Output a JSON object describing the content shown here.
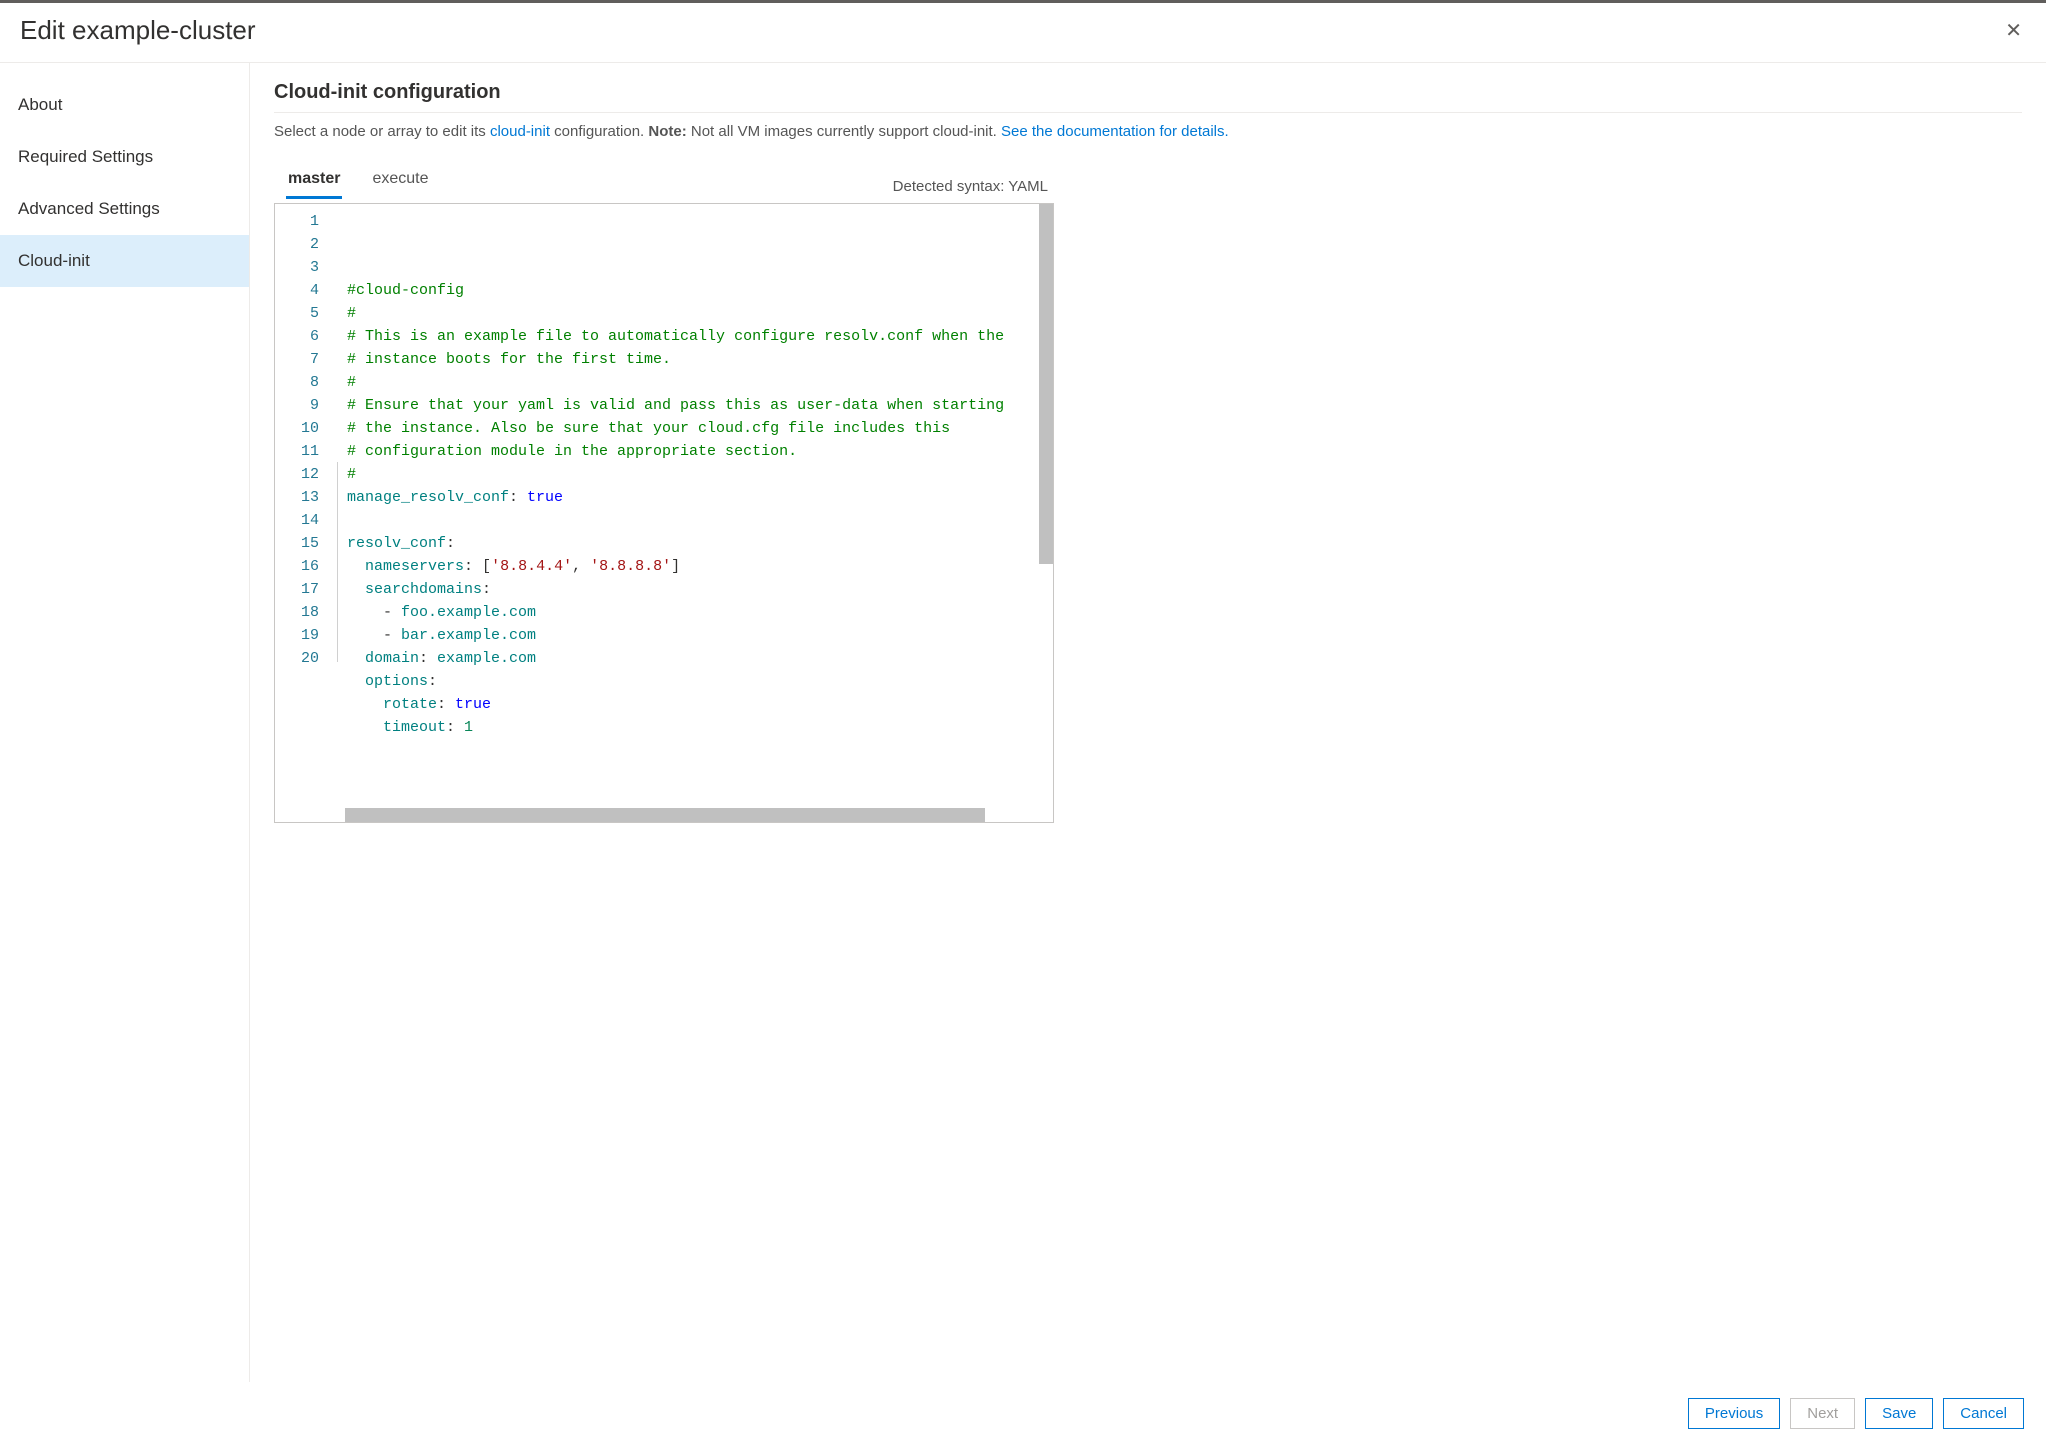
{
  "header": {
    "title": "Edit example-cluster"
  },
  "sidebar": {
    "items": [
      {
        "label": "About",
        "active": false
      },
      {
        "label": "Required Settings",
        "active": false
      },
      {
        "label": "Advanced Settings",
        "active": false
      },
      {
        "label": "Cloud-init",
        "active": true
      }
    ]
  },
  "main": {
    "section_title": "Cloud-init configuration",
    "desc_pre": "Select a node or array to edit its ",
    "desc_link1": "cloud-init",
    "desc_mid": " configuration. ",
    "desc_note_label": "Note:",
    "desc_note_text": " Not all VM images currently support cloud-init. ",
    "desc_link2": "See the documentation for details.",
    "tabs": [
      {
        "label": "master",
        "active": true
      },
      {
        "label": "execute",
        "active": false
      }
    ],
    "syntax_label": "Detected syntax: YAML"
  },
  "editor": {
    "lines": [
      [
        {
          "cls": "c-comment",
          "t": "#cloud-config"
        }
      ],
      [
        {
          "cls": "c-comment",
          "t": "#"
        }
      ],
      [
        {
          "cls": "c-comment",
          "t": "# This is an example file to automatically configure resolv.conf when the"
        }
      ],
      [
        {
          "cls": "c-comment",
          "t": "# instance boots for the first time."
        }
      ],
      [
        {
          "cls": "c-comment",
          "t": "#"
        }
      ],
      [
        {
          "cls": "c-comment",
          "t": "# Ensure that your yaml is valid and pass this as user-data when starting"
        }
      ],
      [
        {
          "cls": "c-comment",
          "t": "# the instance. Also be sure that your cloud.cfg file includes this"
        }
      ],
      [
        {
          "cls": "c-comment",
          "t": "# configuration module in the appropriate section."
        }
      ],
      [
        {
          "cls": "c-comment",
          "t": "#"
        }
      ],
      [
        {
          "cls": "c-key",
          "t": "manage_resolv_conf"
        },
        {
          "cls": "c-colon",
          "t": ": "
        },
        {
          "cls": "c-bool",
          "t": "true"
        }
      ],
      [],
      [
        {
          "cls": "c-key",
          "t": "resolv_conf"
        },
        {
          "cls": "c-colon",
          "t": ":"
        }
      ],
      [
        {
          "cls": "c-plain",
          "t": "  "
        },
        {
          "cls": "c-key",
          "t": "nameservers"
        },
        {
          "cls": "c-colon",
          "t": ": ["
        },
        {
          "cls": "c-string",
          "t": "'8.8.4.4'"
        },
        {
          "cls": "c-colon",
          "t": ", "
        },
        {
          "cls": "c-string",
          "t": "'8.8.8.8'"
        },
        {
          "cls": "c-colon",
          "t": "]"
        }
      ],
      [
        {
          "cls": "c-plain",
          "t": "  "
        },
        {
          "cls": "c-key",
          "t": "searchdomains"
        },
        {
          "cls": "c-colon",
          "t": ":"
        }
      ],
      [
        {
          "cls": "c-plain",
          "t": "    - "
        },
        {
          "cls": "c-key",
          "t": "foo.example.com"
        }
      ],
      [
        {
          "cls": "c-plain",
          "t": "    - "
        },
        {
          "cls": "c-key",
          "t": "bar.example.com"
        }
      ],
      [
        {
          "cls": "c-plain",
          "t": "  "
        },
        {
          "cls": "c-key",
          "t": "domain"
        },
        {
          "cls": "c-colon",
          "t": ": "
        },
        {
          "cls": "c-key",
          "t": "example.com"
        }
      ],
      [
        {
          "cls": "c-plain",
          "t": "  "
        },
        {
          "cls": "c-key",
          "t": "options"
        },
        {
          "cls": "c-colon",
          "t": ":"
        }
      ],
      [
        {
          "cls": "c-plain",
          "t": "    "
        },
        {
          "cls": "c-key",
          "t": "rotate"
        },
        {
          "cls": "c-colon",
          "t": ": "
        },
        {
          "cls": "c-bool",
          "t": "true"
        }
      ],
      [
        {
          "cls": "c-plain",
          "t": "    "
        },
        {
          "cls": "c-key",
          "t": "timeout"
        },
        {
          "cls": "c-colon",
          "t": ": "
        },
        {
          "cls": "c-num",
          "t": "1"
        }
      ]
    ]
  },
  "footer": {
    "previous": "Previous",
    "next": "Next",
    "save": "Save",
    "cancel": "Cancel"
  }
}
